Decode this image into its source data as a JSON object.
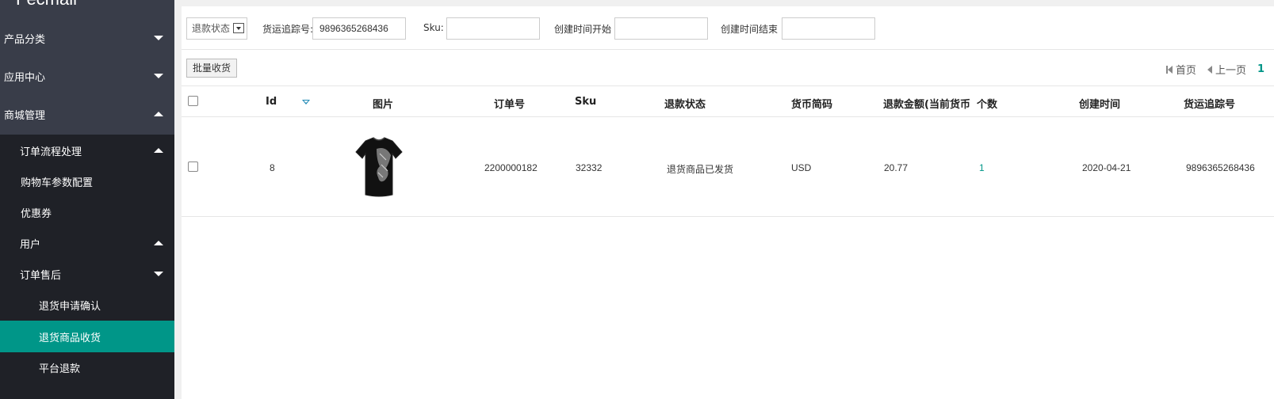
{
  "sidebar": {
    "brand": "Fecmall",
    "items": [
      {
        "label": "产品分类",
        "arrow": "down"
      },
      {
        "label": "应用中心",
        "arrow": "down"
      },
      {
        "label": "商城管理",
        "arrow": "up"
      },
      {
        "label": "订单流程处理",
        "arrow": "up"
      },
      {
        "label": "购物车参数配置"
      },
      {
        "label": "优惠券"
      },
      {
        "label": "用户",
        "arrow": "up"
      },
      {
        "label": "订单售后",
        "arrow": "down"
      },
      {
        "label": "退货申请确认"
      },
      {
        "label": "退货商品收货",
        "active": true
      },
      {
        "label": "平台退款"
      }
    ]
  },
  "filters": {
    "status_select": "退款状态",
    "tracking_label": "货运追踪号:",
    "tracking_value": "9896365268436",
    "sku_label": "Sku:",
    "sku_value": "",
    "created_start_label": "创建时间开始",
    "created_start_value": "",
    "created_end_label": "创建时间结束",
    "created_end_value": ""
  },
  "toolbar": {
    "bulk_receive": "批量收货"
  },
  "pager": {
    "first": "首页",
    "prev": "上一页",
    "current": "1"
  },
  "table": {
    "headers": {
      "id": "Id",
      "image": "图片",
      "order_no": "订单号",
      "sku": "Sku",
      "refund_status": "退款状态",
      "currency": "货币简码",
      "refund_amount": "退款金额(当前货币",
      "count": "个数",
      "created_at": "创建时间",
      "tracking_no": "货运追踪号"
    },
    "rows": [
      {
        "id": "8",
        "image": "black-tshirt-image",
        "order_no": "2200000182",
        "sku": "32332",
        "refund_status": "退货商品已发货",
        "currency": "USD",
        "refund_amount": "20.77",
        "count": "1",
        "created_at": "2020-04-21",
        "tracking_no": "9896365268436"
      }
    ]
  },
  "colors": {
    "sidebar_bg": "#393d49",
    "submenu_bg": "#1f2127",
    "active_bg": "#009688",
    "accent": "#009688"
  }
}
